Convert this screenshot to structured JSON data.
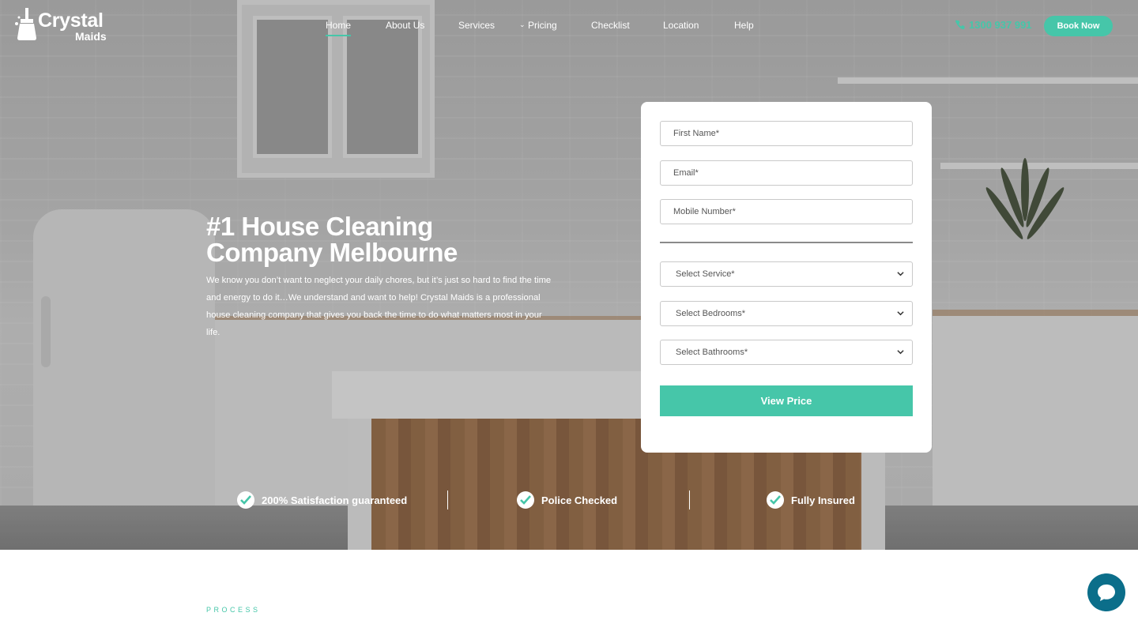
{
  "brand": {
    "name_line1": "Crystal",
    "name_line2": "Maids"
  },
  "nav": {
    "items": [
      {
        "label": "Home",
        "active": true
      },
      {
        "label": "About Us"
      },
      {
        "label": "Services"
      },
      {
        "label": "Pricing"
      },
      {
        "label": "Checklist"
      },
      {
        "label": "Location"
      },
      {
        "label": "Help"
      }
    ],
    "phone": "1300 937 991",
    "book_label": "Book Now"
  },
  "hero": {
    "title_line1": "#1 House Cleaning",
    "title_line2": "Company Melbourne",
    "description": "We know you don’t want to neglect your daily chores, but it’s just so hard to find the time and energy to do it…We understand and want to help! Crystal Maids is a professional house cleaning company that gives you back the time to do what matters most in your life."
  },
  "form": {
    "first_name_placeholder": "First Name*",
    "email_placeholder": "Email*",
    "mobile_placeholder": "Mobile Number*",
    "service_selected": "Select Service*",
    "bedrooms_selected": "Select Bedrooms*",
    "bathrooms_selected": "Select Bathrooms*",
    "submit_label": "View Price"
  },
  "badges": [
    {
      "label": "200% Satisfaction guaranteed"
    },
    {
      "label": "Police Checked"
    },
    {
      "label": "Fully Insured"
    }
  ],
  "next_section": {
    "eyebrow": "PROCESS"
  },
  "colors": {
    "accent": "#46c6a9",
    "chat": "#0b6e8a",
    "white": "#ffffff"
  },
  "icons": {
    "phone": "phone-icon",
    "check": "check-icon",
    "chevron": "chevron-down-icon",
    "chat": "chat-icon"
  }
}
